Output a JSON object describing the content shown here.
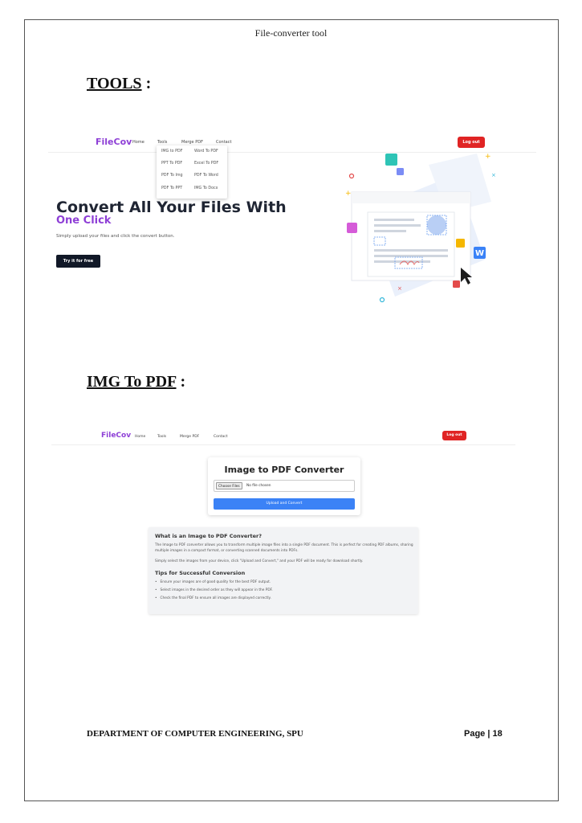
{
  "document": {
    "header": "File-converter tool",
    "section1_title": "TOOLS",
    "section1_suffix": " :",
    "section2_title": "IMG To PDF",
    "section2_suffix": " :",
    "footer_left": "DEPARTMENT OF COMPUTER ENGINEERING, SPU",
    "footer_right": "Page | 18"
  },
  "nav": {
    "brand": "FileCov",
    "links": [
      "Home",
      "Tools",
      "Merge PDF",
      "Contact"
    ],
    "logout": "Log out"
  },
  "tools_menu": {
    "left": [
      "IMG to PDF",
      "PPT To PDF",
      "PDF To Img",
      "PDF To PPT"
    ],
    "right": [
      "Word To PDF",
      "Excel To PDF",
      "PDF To Word",
      "IMG To Docx"
    ]
  },
  "hero": {
    "title": "Convert All Your Files With",
    "subtitle": "One Click",
    "description": "Simply upload your files and click the convert button.",
    "cta": "Try it for free"
  },
  "converter": {
    "title": "Image to PDF Converter",
    "choose_files": "Choose Files",
    "no_file": "No file chosen",
    "upload": "Upload and Convert"
  },
  "info": {
    "heading": "What is an Image to PDF Converter?",
    "para1": "The Image to PDF converter allows you to transform multiple image files into a single PDF document. This is perfect for creating PDF albums, sharing multiple images in a compact format, or converting scanned documents into PDFs.",
    "para2": "Simply select the images from your device, click \"Upload and Convert,\" and your PDF will be ready for download shortly.",
    "tips_heading": "Tips for Successful Conversion",
    "tips": [
      "Ensure your images are of good quality for the best PDF output.",
      "Select images in the desired order as they will appear in the PDF.",
      "Check the final PDF to ensure all images are displayed correctly."
    ]
  },
  "colors": {
    "brand": "#8e3fd6",
    "logout": "#e02424",
    "upload": "#3b82f6",
    "cta": "#111827"
  }
}
